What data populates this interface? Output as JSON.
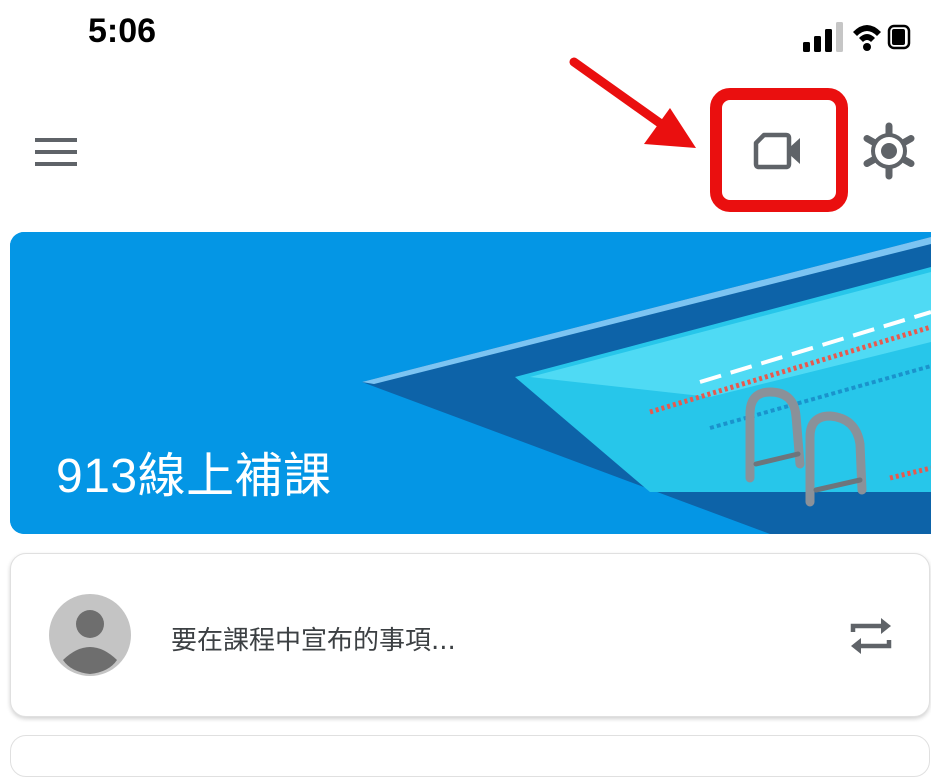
{
  "status_bar": {
    "time": "5:06",
    "icons": [
      "signal-icon",
      "wifi-icon",
      "battery-icon"
    ]
  },
  "app_bar": {
    "icons": [
      "menu-icon",
      "video-camera-icon",
      "gear-icon"
    ]
  },
  "colors": {
    "banner": "#0496e5",
    "highlight": "#ea0f0f"
  },
  "class_banner": {
    "title": "913線上補課"
  },
  "stream": {
    "announce_placeholder": "要在課程中宣布的事項...",
    "icons": [
      "avatar-icon",
      "repost-icon"
    ]
  }
}
